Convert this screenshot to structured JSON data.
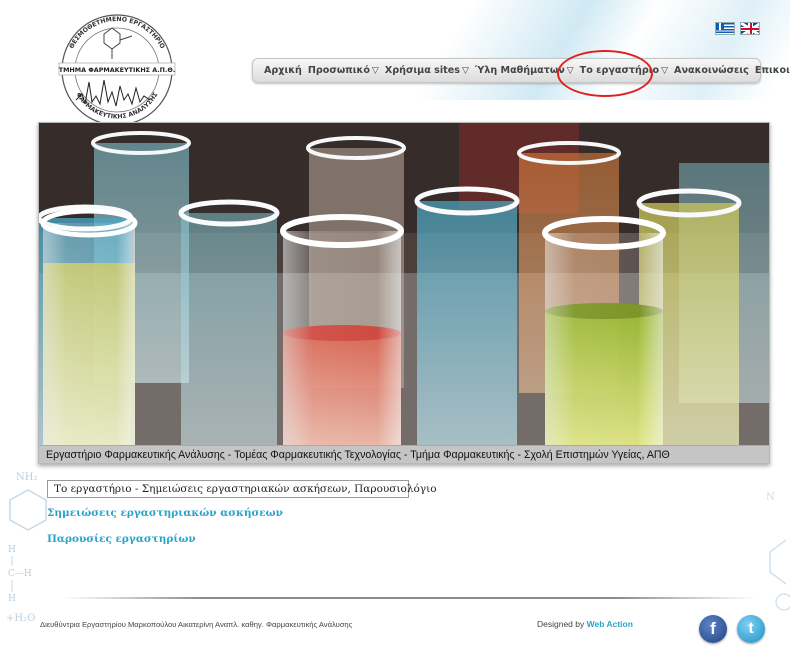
{
  "logo": {
    "arc_top": "ΘΕΣΜΟΘΕΤΗΜΕΝΟ ΕΡΓΑΣΤΗΡΙΟ",
    "band": "ΤΜΗΜΑ ΦΑΡΜΑΚΕΥΤΙΚΗΣ Α.Π.Θ.",
    "arc_bottom": "ΦΑΡΜΑΚΕΥΤΙΚΗΣ ΑΝΑΛΥΣΗΣ"
  },
  "languages": [
    {
      "name": "greek-flag-icon"
    },
    {
      "name": "uk-flag-icon"
    }
  ],
  "nav": {
    "items": [
      {
        "label": "Αρχική",
        "has_dropdown": false
      },
      {
        "label": "Προσωπικό",
        "has_dropdown": true
      },
      {
        "label": "Χρήσιμα sites",
        "has_dropdown": true
      },
      {
        "label": "Ύλη Μαθήματων",
        "has_dropdown": true
      },
      {
        "label": "Το εργαστήριο",
        "has_dropdown": true
      },
      {
        "label": "Ανακοινώσεις",
        "has_dropdown": false
      },
      {
        "label": "Επικοινωνία",
        "has_dropdown": false
      }
    ],
    "dropdown_arrow": "▽"
  },
  "banner": {
    "caption": "Εργαστήριο Φαρμακευτικής Ανάλυσης - Τομέας Φαρμακευτικής Τεχνολογίας - Τμήμα Φαρμακευτικής - Σχολή Επιστημών Υγείας, ΑΠΘ"
  },
  "content": {
    "breadcrumb": "Το εργαστήριο - Σημειώσεις εργαστηριακών ασκήσεων, Παρουσιολόγιο",
    "links": [
      {
        "label": "Σημειώσεις εργαστηριακών ασκήσεων"
      },
      {
        "label": "Παρουσίες εργαστηρίων"
      }
    ]
  },
  "footer": {
    "director": "Διευθύντρια Εργαστηρίου Μαρκοπούλου Αικατερίνη Αναπλ. καθηγ. Φαρμακευτικής Ανάλυσης",
    "designed_by_prefix": "Designed by",
    "designer_link": "Web Action"
  },
  "colors": {
    "link": "#2aa3c9",
    "highlight": "#e02020",
    "facebook": "#3b5998",
    "twitter": "#1d8fc3"
  }
}
